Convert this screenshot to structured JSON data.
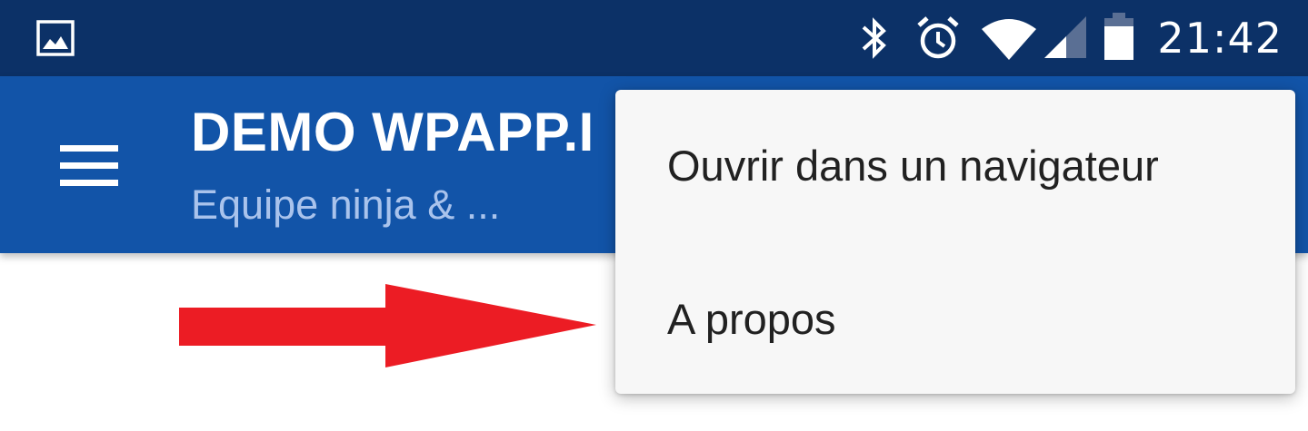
{
  "status_bar": {
    "time": "21:42",
    "left_icons": [
      "gallery-icon"
    ],
    "right_icons": [
      "bluetooth-icon",
      "alarm-icon",
      "wifi-icon",
      "signal-icon",
      "battery-icon"
    ],
    "background": "#0c3167"
  },
  "app_bar": {
    "title": "DEMO WPAPP.I",
    "subtitle": "Equipe ninja & ...",
    "nav_icon": "menu-icon",
    "background": "#1254a8"
  },
  "overflow_menu": {
    "items": [
      {
        "label": "Ouvrir dans un navigateur"
      },
      {
        "label": "A propos"
      }
    ]
  },
  "annotation": {
    "arrow_color": "#ec1c24",
    "points_to": "A propos"
  }
}
